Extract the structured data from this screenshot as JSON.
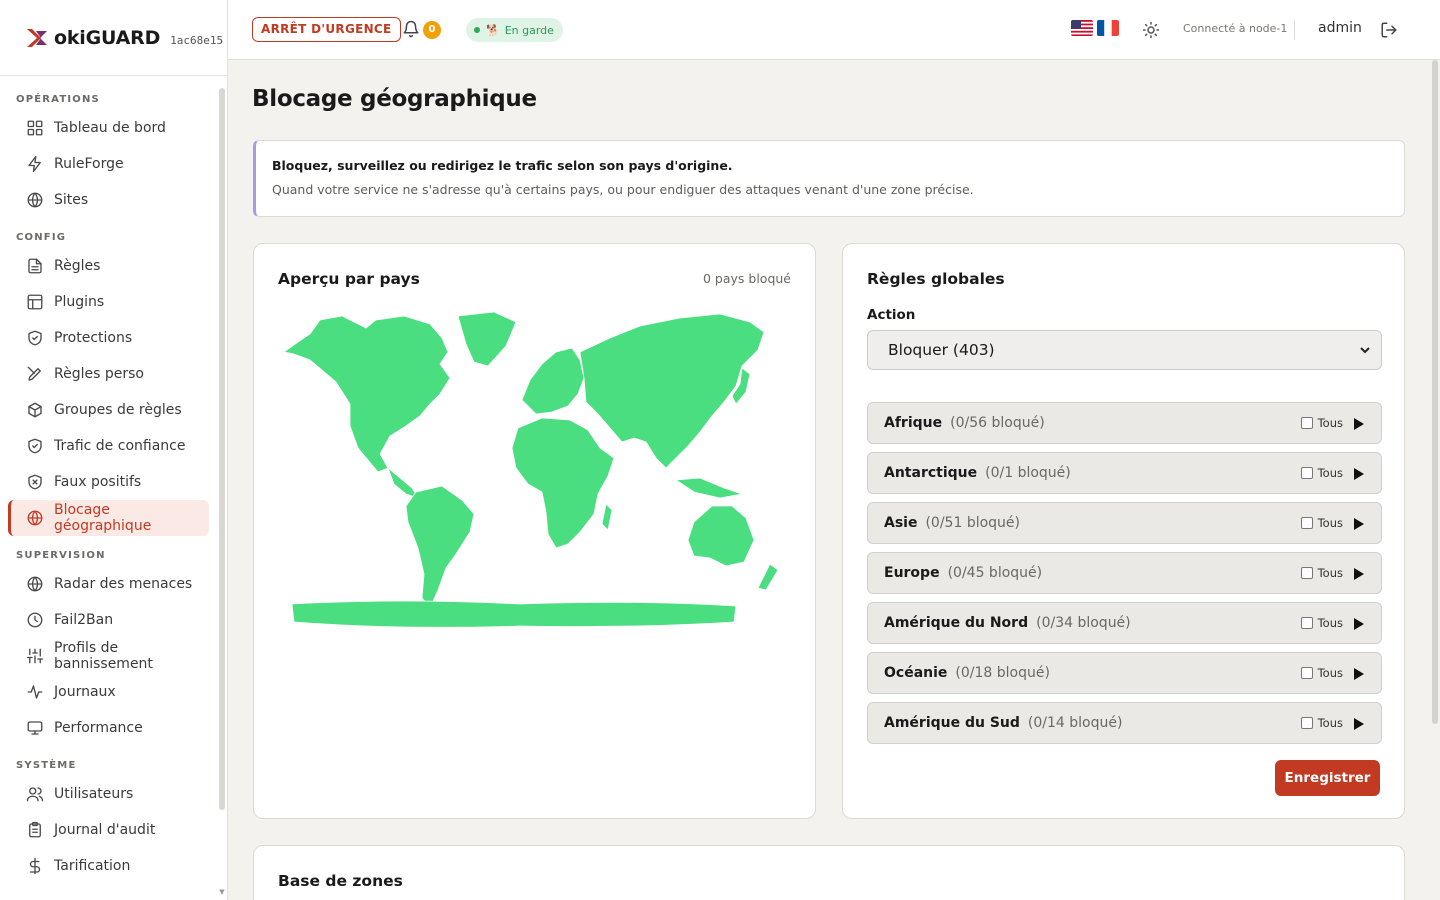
{
  "brand": {
    "name": "okiGUARD",
    "hash": "1ac68e15",
    "accent": "#c23a22"
  },
  "sidebar": {
    "sections": [
      {
        "title": "OPÉRATIONS",
        "items": [
          {
            "label": "Tableau de bord",
            "icon": "grid-icon"
          },
          {
            "label": "RuleForge",
            "icon": "bolt-icon"
          },
          {
            "label": "Sites",
            "icon": "globe-icon"
          }
        ]
      },
      {
        "title": "CONFIG",
        "items": [
          {
            "label": "Règles",
            "icon": "document-icon"
          },
          {
            "label": "Plugins",
            "icon": "layout-icon"
          },
          {
            "label": "Protections",
            "icon": "shield-check-icon"
          },
          {
            "label": "Règles perso",
            "icon": "pen-icon"
          },
          {
            "label": "Groupes de règles",
            "icon": "cube-icon"
          },
          {
            "label": "Trafic de confiance",
            "icon": "shield-check-icon"
          },
          {
            "label": "Faux positifs",
            "icon": "shield-x-icon"
          },
          {
            "label": "Blocage géographique",
            "icon": "globe-icon",
            "active": true
          }
        ]
      },
      {
        "title": "SUPERVISION",
        "items": [
          {
            "label": "Radar des menaces",
            "icon": "globe-icon"
          },
          {
            "label": "Fail2Ban",
            "icon": "clock-icon"
          },
          {
            "label": "Profils de bannissement",
            "icon": "sliders-icon"
          },
          {
            "label": "Journaux",
            "icon": "activity-icon"
          },
          {
            "label": "Performance",
            "icon": "monitor-icon"
          }
        ]
      },
      {
        "title": "SYSTÈME",
        "items": [
          {
            "label": "Utilisateurs",
            "icon": "users-icon"
          },
          {
            "label": "Journal d'audit",
            "icon": "clipboard-icon"
          },
          {
            "label": "Tarification",
            "icon": "dollar-icon"
          }
        ]
      }
    ]
  },
  "header": {
    "emergency_label": "ARRÊT D'URGENCE",
    "notifications_count": "0",
    "status_label": "En garde",
    "node_label": "Connecté à node-1",
    "user": "admin"
  },
  "main": {
    "title": "Blocage géographique",
    "info": {
      "title": "Bloquez, surveillez ou redirigez le trafic selon son pays d'origine.",
      "description": "Quand votre service ne s'adresse qu'à certains pays, ou pour endiguer des attaques venant d'une zone précise."
    },
    "overview": {
      "title": "Aperçu par pays",
      "blocked_summary": "0 pays bloqué",
      "map_color": "#4ade80"
    },
    "rules": {
      "title": "Règles globales",
      "action_label": "Action",
      "action_value": "Bloquer (403)",
      "all_label": "Tous",
      "regions": [
        {
          "name": "Afrique",
          "count": "(0/56 bloqué)"
        },
        {
          "name": "Antarctique",
          "count": "(0/1 bloqué)"
        },
        {
          "name": "Asie",
          "count": "(0/51 bloqué)"
        },
        {
          "name": "Europe",
          "count": "(0/45 bloqué)"
        },
        {
          "name": "Amérique du Nord",
          "count": "(0/34 bloqué)"
        },
        {
          "name": "Océanie",
          "count": "(0/18 bloqué)"
        },
        {
          "name": "Amérique du Sud",
          "count": "(0/14 bloqué)"
        }
      ],
      "save_label": "Enregistrer"
    },
    "zones": {
      "title": "Base de zones"
    }
  }
}
